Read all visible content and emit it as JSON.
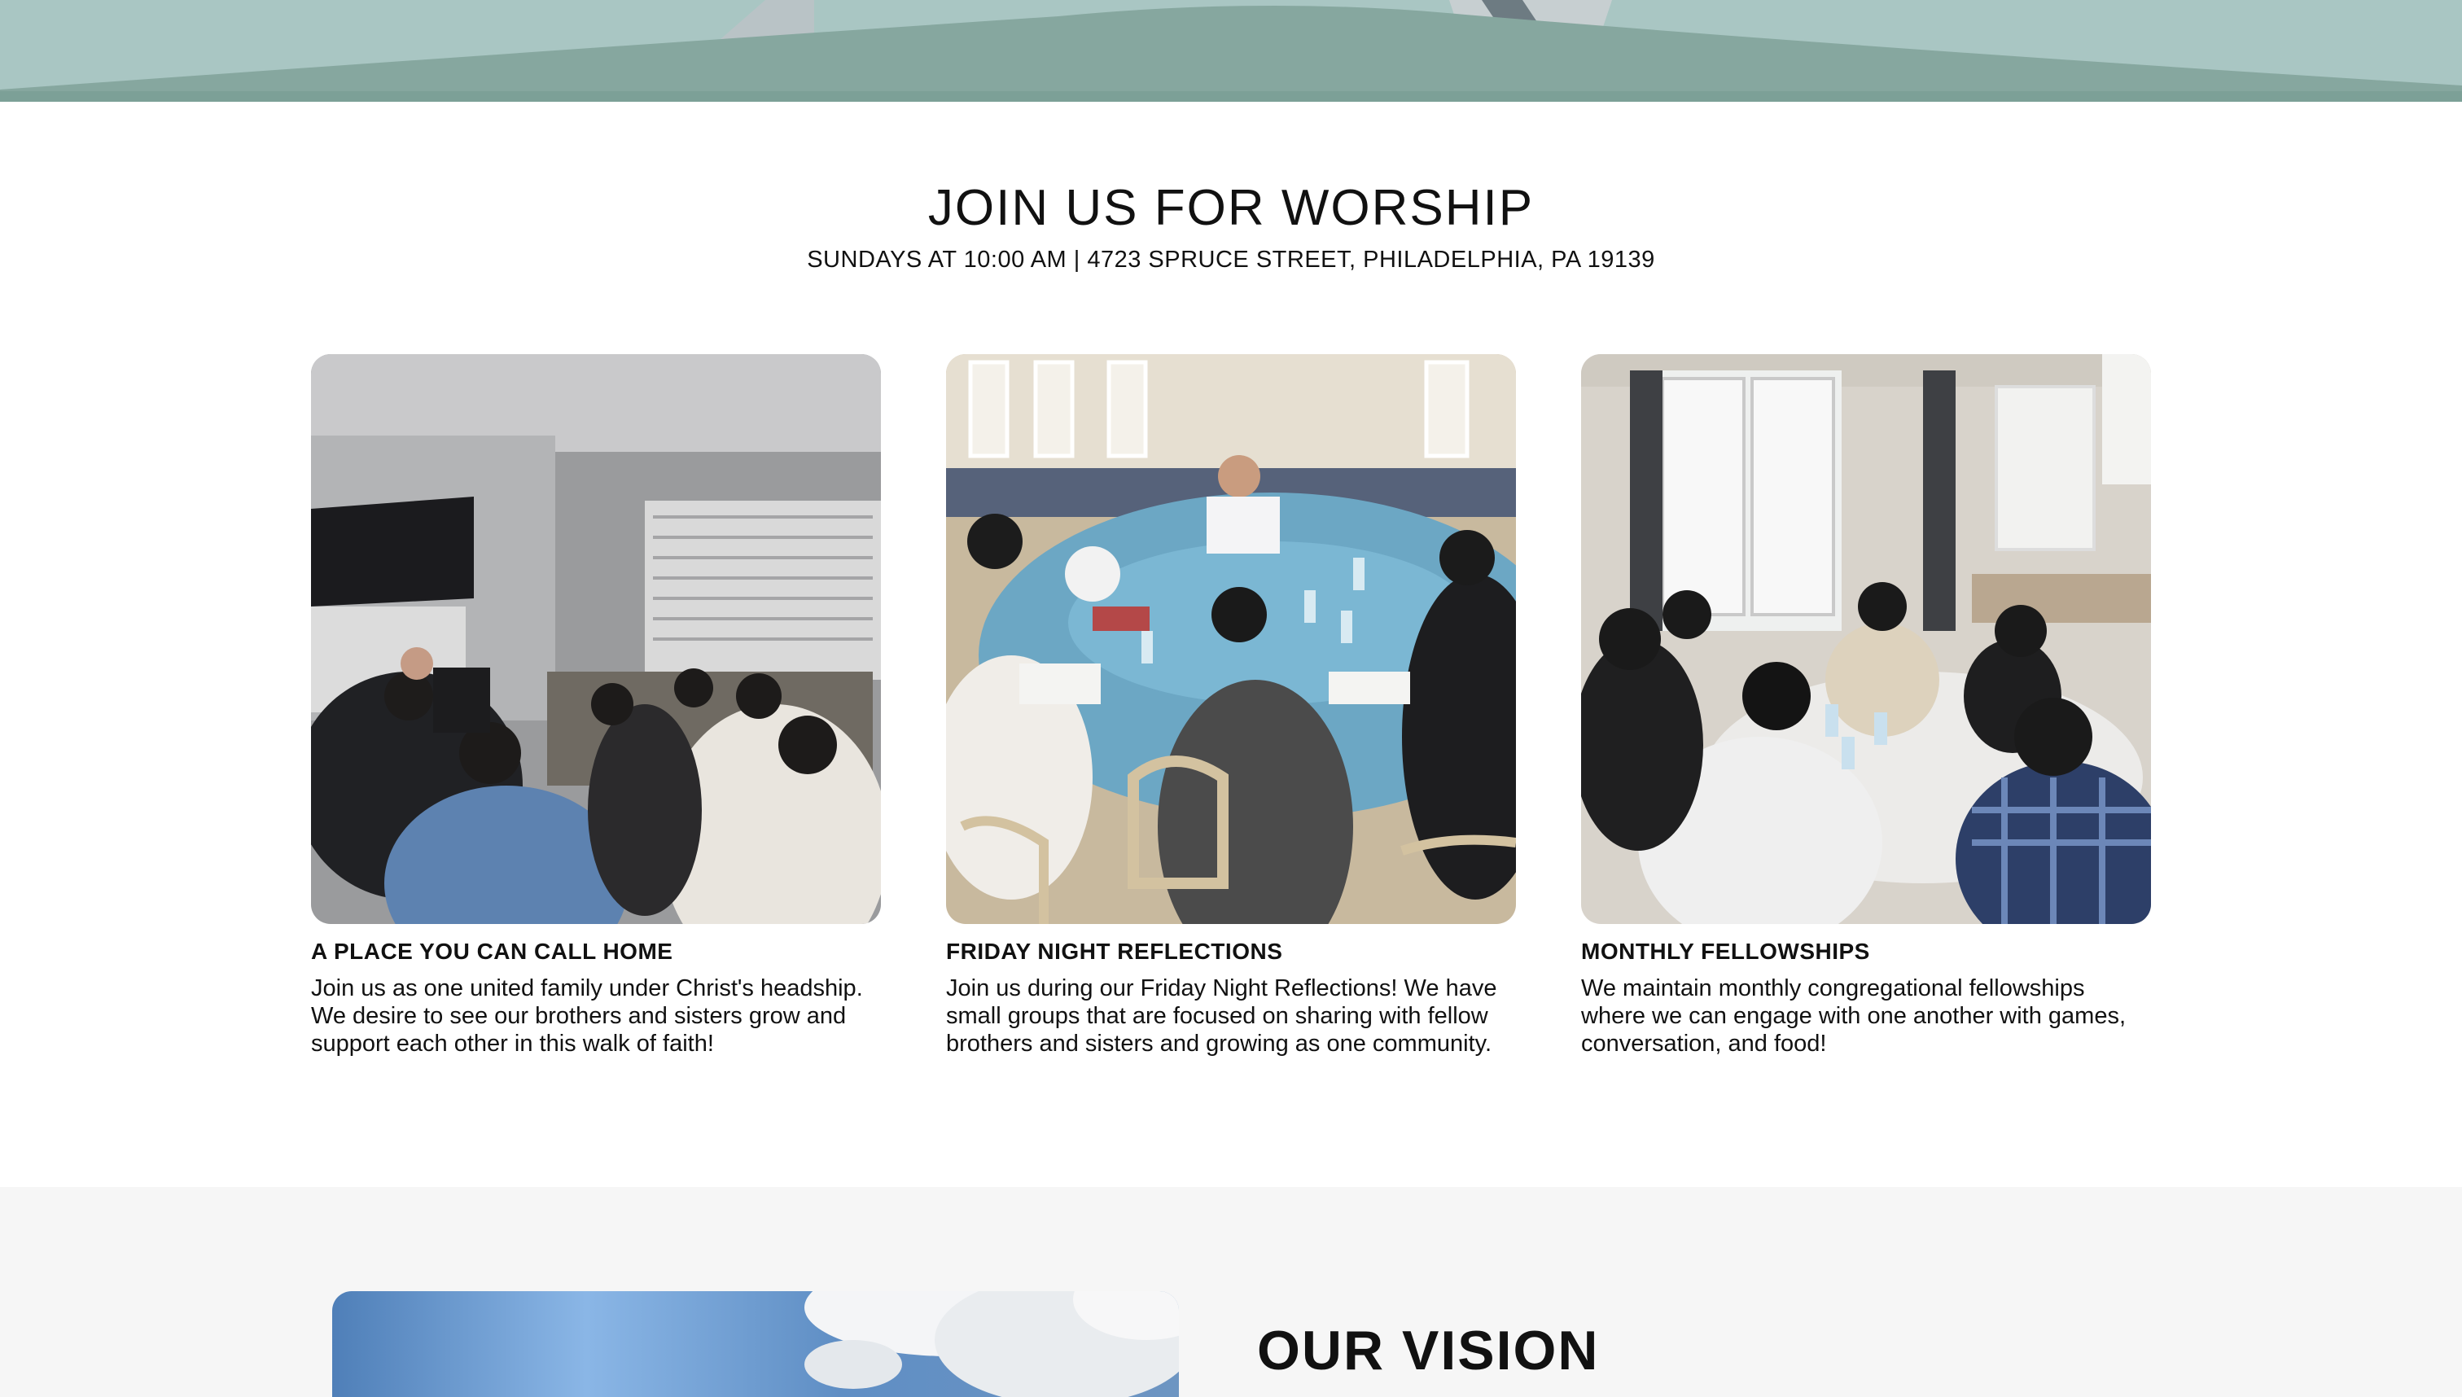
{
  "worship": {
    "title": "JOIN US FOR WORSHIP",
    "subtitle": "SUNDAYS AT 10:00 AM | 4723 SPRUCE STREET, PHILADELPHIA, PA 19139"
  },
  "cards": [
    {
      "title": "A PLACE YOU CAN CALL HOME",
      "body": "Join us as one united family under Christ's headship. We desire to see our brothers and sisters grow and support each other in this walk of faith!",
      "photo": "living-room-worship-photo"
    },
    {
      "title": "FRIDAY NIGHT REFLECTIONS",
      "body": "Join us during our Friday Night Reflections! We have small groups that are focused on sharing with fellow brothers and sisters and growing as one community.",
      "photo": "round-table-prayer-photo"
    },
    {
      "title": "MONTHLY FELLOWSHIPS",
      "body": "We maintain monthly congregational fellowships where we can engage with one another with games, conversation, and food!",
      "photo": "kitchen-fellowship-photo"
    }
  ],
  "vision": {
    "title": "OUR VISION",
    "photo": "sky-clouds-photo"
  },
  "colors": {
    "hero_teal": "#86a79f",
    "hero_light": "#a9c6c3",
    "section_gray": "#f6f6f6",
    "text": "#111111"
  }
}
